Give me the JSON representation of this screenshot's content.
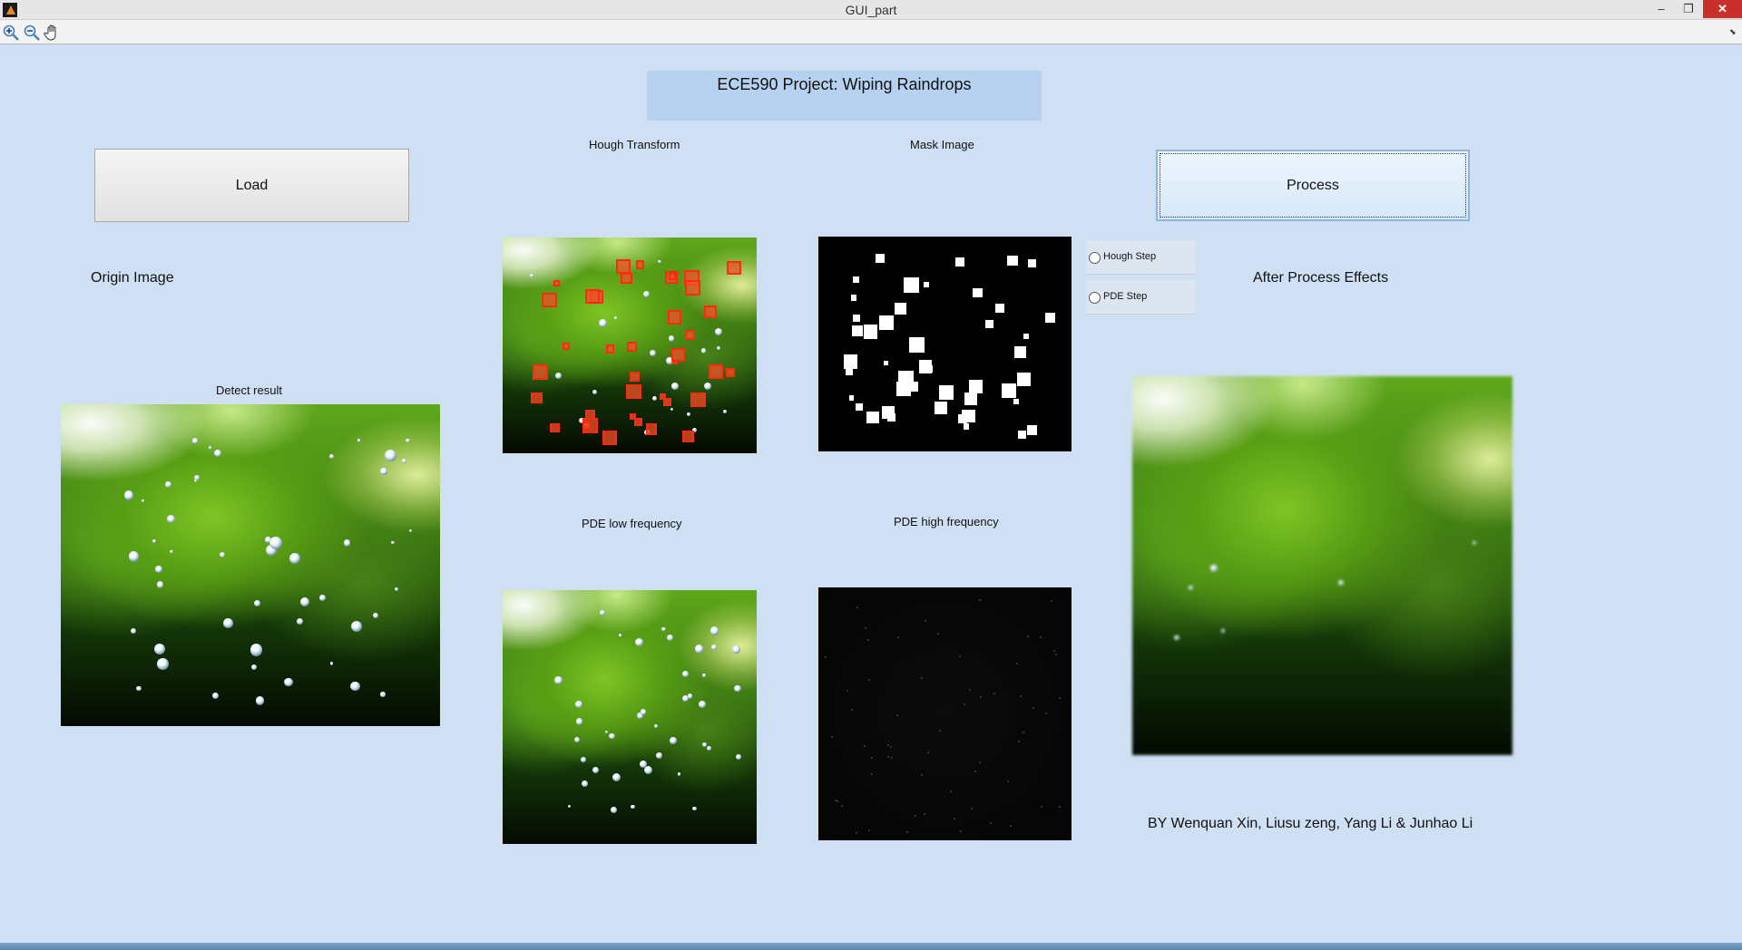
{
  "window": {
    "title": "GUI_part",
    "controls": {
      "minimize": "–",
      "maximize": "❐",
      "close": "✕"
    }
  },
  "toolbar": {
    "icons": [
      "zoom-in-icon",
      "zoom-out-icon",
      "pan-hand-icon"
    ],
    "expand": "⬊"
  },
  "header": {
    "title": "ECE590 Project: Wiping Raindrops"
  },
  "buttons": {
    "load": "Load",
    "process": "Process"
  },
  "labels": {
    "origin_image": "Origin Image",
    "detect_result": "Detect result",
    "hough_transform": "Hough Transform",
    "mask_image": "Mask Image",
    "pde_low": "PDE low frequency",
    "pde_high": "PDE high frequency",
    "after_process": "After Process Effects",
    "credits": "BY Wenquan Xin, Liusu zeng, Yang Li & Junhao Li"
  },
  "radios": [
    {
      "label": "Hough Step",
      "selected": false
    },
    {
      "label": "PDE Step",
      "selected": false
    }
  ],
  "colors": {
    "background": "#cfe0f5",
    "title_panel": "#b7d2f0",
    "hough_box": "#ff2a10"
  }
}
